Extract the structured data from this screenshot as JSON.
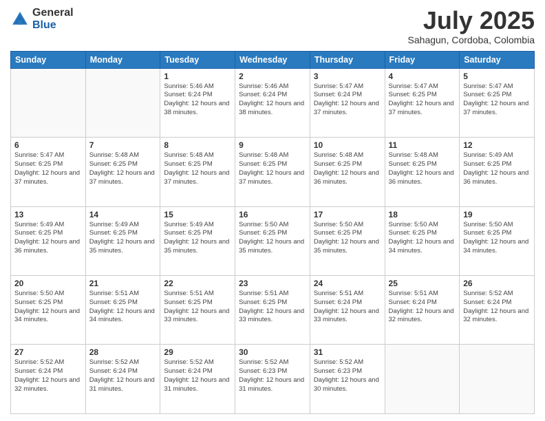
{
  "logo": {
    "general": "General",
    "blue": "Blue"
  },
  "title": "July 2025",
  "subtitle": "Sahagun, Cordoba, Colombia",
  "weekdays": [
    "Sunday",
    "Monday",
    "Tuesday",
    "Wednesday",
    "Thursday",
    "Friday",
    "Saturday"
  ],
  "weeks": [
    [
      {
        "day": "",
        "sunrise": "",
        "sunset": "",
        "daylight": ""
      },
      {
        "day": "",
        "sunrise": "",
        "sunset": "",
        "daylight": ""
      },
      {
        "day": "1",
        "sunrise": "Sunrise: 5:46 AM",
        "sunset": "Sunset: 6:24 PM",
        "daylight": "Daylight: 12 hours and 38 minutes."
      },
      {
        "day": "2",
        "sunrise": "Sunrise: 5:46 AM",
        "sunset": "Sunset: 6:24 PM",
        "daylight": "Daylight: 12 hours and 38 minutes."
      },
      {
        "day": "3",
        "sunrise": "Sunrise: 5:47 AM",
        "sunset": "Sunset: 6:24 PM",
        "daylight": "Daylight: 12 hours and 37 minutes."
      },
      {
        "day": "4",
        "sunrise": "Sunrise: 5:47 AM",
        "sunset": "Sunset: 6:25 PM",
        "daylight": "Daylight: 12 hours and 37 minutes."
      },
      {
        "day": "5",
        "sunrise": "Sunrise: 5:47 AM",
        "sunset": "Sunset: 6:25 PM",
        "daylight": "Daylight: 12 hours and 37 minutes."
      }
    ],
    [
      {
        "day": "6",
        "sunrise": "Sunrise: 5:47 AM",
        "sunset": "Sunset: 6:25 PM",
        "daylight": "Daylight: 12 hours and 37 minutes."
      },
      {
        "day": "7",
        "sunrise": "Sunrise: 5:48 AM",
        "sunset": "Sunset: 6:25 PM",
        "daylight": "Daylight: 12 hours and 37 minutes."
      },
      {
        "day": "8",
        "sunrise": "Sunrise: 5:48 AM",
        "sunset": "Sunset: 6:25 PM",
        "daylight": "Daylight: 12 hours and 37 minutes."
      },
      {
        "day": "9",
        "sunrise": "Sunrise: 5:48 AM",
        "sunset": "Sunset: 6:25 PM",
        "daylight": "Daylight: 12 hours and 37 minutes."
      },
      {
        "day": "10",
        "sunrise": "Sunrise: 5:48 AM",
        "sunset": "Sunset: 6:25 PM",
        "daylight": "Daylight: 12 hours and 36 minutes."
      },
      {
        "day": "11",
        "sunrise": "Sunrise: 5:48 AM",
        "sunset": "Sunset: 6:25 PM",
        "daylight": "Daylight: 12 hours and 36 minutes."
      },
      {
        "day": "12",
        "sunrise": "Sunrise: 5:49 AM",
        "sunset": "Sunset: 6:25 PM",
        "daylight": "Daylight: 12 hours and 36 minutes."
      }
    ],
    [
      {
        "day": "13",
        "sunrise": "Sunrise: 5:49 AM",
        "sunset": "Sunset: 6:25 PM",
        "daylight": "Daylight: 12 hours and 36 minutes."
      },
      {
        "day": "14",
        "sunrise": "Sunrise: 5:49 AM",
        "sunset": "Sunset: 6:25 PM",
        "daylight": "Daylight: 12 hours and 35 minutes."
      },
      {
        "day": "15",
        "sunrise": "Sunrise: 5:49 AM",
        "sunset": "Sunset: 6:25 PM",
        "daylight": "Daylight: 12 hours and 35 minutes."
      },
      {
        "day": "16",
        "sunrise": "Sunrise: 5:50 AM",
        "sunset": "Sunset: 6:25 PM",
        "daylight": "Daylight: 12 hours and 35 minutes."
      },
      {
        "day": "17",
        "sunrise": "Sunrise: 5:50 AM",
        "sunset": "Sunset: 6:25 PM",
        "daylight": "Daylight: 12 hours and 35 minutes."
      },
      {
        "day": "18",
        "sunrise": "Sunrise: 5:50 AM",
        "sunset": "Sunset: 6:25 PM",
        "daylight": "Daylight: 12 hours and 34 minutes."
      },
      {
        "day": "19",
        "sunrise": "Sunrise: 5:50 AM",
        "sunset": "Sunset: 6:25 PM",
        "daylight": "Daylight: 12 hours and 34 minutes."
      }
    ],
    [
      {
        "day": "20",
        "sunrise": "Sunrise: 5:50 AM",
        "sunset": "Sunset: 6:25 PM",
        "daylight": "Daylight: 12 hours and 34 minutes."
      },
      {
        "day": "21",
        "sunrise": "Sunrise: 5:51 AM",
        "sunset": "Sunset: 6:25 PM",
        "daylight": "Daylight: 12 hours and 34 minutes."
      },
      {
        "day": "22",
        "sunrise": "Sunrise: 5:51 AM",
        "sunset": "Sunset: 6:25 PM",
        "daylight": "Daylight: 12 hours and 33 minutes."
      },
      {
        "day": "23",
        "sunrise": "Sunrise: 5:51 AM",
        "sunset": "Sunset: 6:25 PM",
        "daylight": "Daylight: 12 hours and 33 minutes."
      },
      {
        "day": "24",
        "sunrise": "Sunrise: 5:51 AM",
        "sunset": "Sunset: 6:24 PM",
        "daylight": "Daylight: 12 hours and 33 minutes."
      },
      {
        "day": "25",
        "sunrise": "Sunrise: 5:51 AM",
        "sunset": "Sunset: 6:24 PM",
        "daylight": "Daylight: 12 hours and 32 minutes."
      },
      {
        "day": "26",
        "sunrise": "Sunrise: 5:52 AM",
        "sunset": "Sunset: 6:24 PM",
        "daylight": "Daylight: 12 hours and 32 minutes."
      }
    ],
    [
      {
        "day": "27",
        "sunrise": "Sunrise: 5:52 AM",
        "sunset": "Sunset: 6:24 PM",
        "daylight": "Daylight: 12 hours and 32 minutes."
      },
      {
        "day": "28",
        "sunrise": "Sunrise: 5:52 AM",
        "sunset": "Sunset: 6:24 PM",
        "daylight": "Daylight: 12 hours and 31 minutes."
      },
      {
        "day": "29",
        "sunrise": "Sunrise: 5:52 AM",
        "sunset": "Sunset: 6:24 PM",
        "daylight": "Daylight: 12 hours and 31 minutes."
      },
      {
        "day": "30",
        "sunrise": "Sunrise: 5:52 AM",
        "sunset": "Sunset: 6:23 PM",
        "daylight": "Daylight: 12 hours and 31 minutes."
      },
      {
        "day": "31",
        "sunrise": "Sunrise: 5:52 AM",
        "sunset": "Sunset: 6:23 PM",
        "daylight": "Daylight: 12 hours and 30 minutes."
      },
      {
        "day": "",
        "sunrise": "",
        "sunset": "",
        "daylight": ""
      },
      {
        "day": "",
        "sunrise": "",
        "sunset": "",
        "daylight": ""
      }
    ]
  ]
}
